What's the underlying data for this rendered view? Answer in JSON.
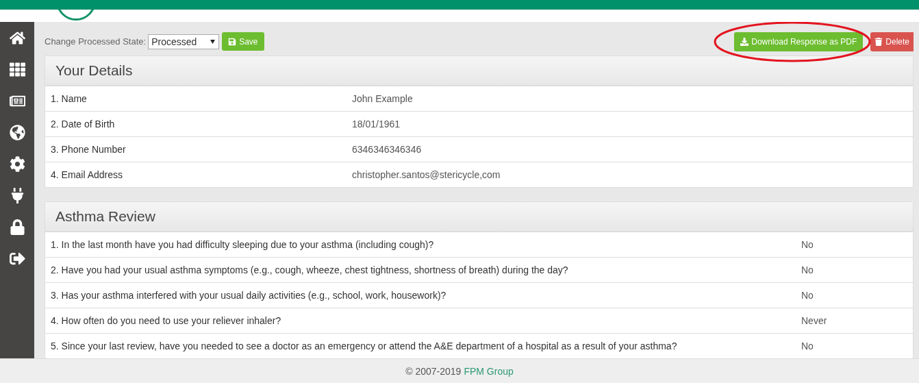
{
  "toolbar": {
    "state_label": "Change Processed State:",
    "state_value": "Processed",
    "save": "Save",
    "download": "Download Response as PDF",
    "download_circled": true,
    "delete": "Delete"
  },
  "panels": [
    {
      "title": "Your Details",
      "kind": "details",
      "rows": [
        {
          "question": "1. Name",
          "answer": "John Example"
        },
        {
          "question": "2. Date of Birth",
          "answer": "18/01/1961"
        },
        {
          "question": "3. Phone Number",
          "answer": "6346346346346"
        },
        {
          "question": "4. Email Address",
          "answer": "christopher.santos@stericycle,com"
        }
      ]
    },
    {
      "title": "Asthma Review",
      "kind": "review",
      "rows": [
        {
          "question": "1. In the last month have you had difficulty sleeping due to your asthma (including cough)?",
          "answer": "No"
        },
        {
          "question": "2. Have you had your usual asthma symptoms (e.g., cough, wheeze, chest tightness, shortness of breath) during the day?",
          "answer": "No"
        },
        {
          "question": "3. Has your asthma interfered with your usual daily activities (e.g., school, work, housework)?",
          "answer": "No"
        },
        {
          "question": "4. How often do you need to use your reliever inhaler?",
          "answer": "Never"
        },
        {
          "question": "5. Since your last review, have you needed to see a doctor as an emergency or attend the A&E department of a hospital as a result of your asthma?",
          "answer": "No"
        }
      ]
    }
  ],
  "footer": {
    "copyright": "© 2007-2019",
    "link": "FPM Group"
  }
}
